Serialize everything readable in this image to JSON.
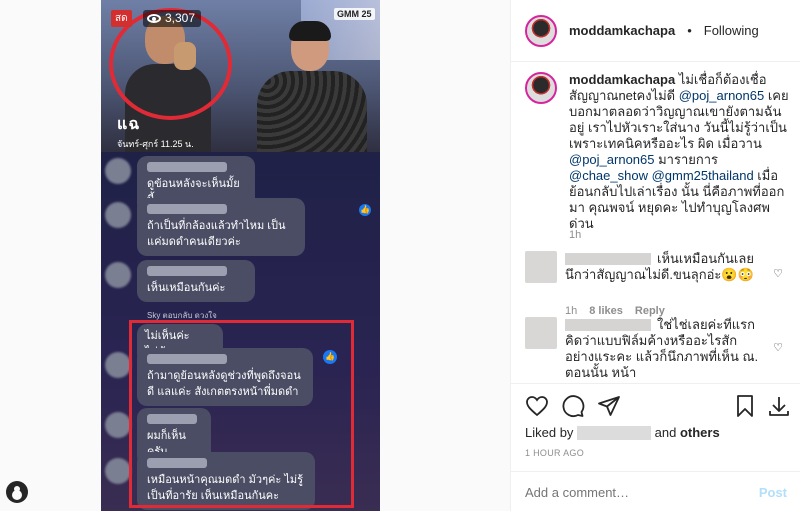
{
  "video": {
    "live_tag": "สด",
    "views": "3,307",
    "channel": "GMM 25",
    "show_logo_main": "แฉ",
    "show_logo_sub": "จันทร์-ศุกร์ 11.25 น."
  },
  "chat_overlay": {
    "messages": [
      {
        "text": "ดูข้อนหลังจะเห็นมั้ยนี้"
      },
      {
        "text": "ถ้าเป็นที่กล้องแล้วทำไหม เป็นแค่มดดำคนเดียวค่ะ"
      },
      {
        "text": "เห็นเหมือนกันค่ะ"
      },
      {
        "text": "ไม่เห็นค่ะ ไม่ทัน"
      },
      {
        "text": "ถ้ามาดูย้อนหลังดูช่วงที่พูดถึงจอนดี แลแค่ะ สังเกตตรงหน้าพี่มดดำ"
      },
      {
        "text": "ผมก็เห็นครับ"
      },
      {
        "text": "เหมือนหน้าคุณมดดำ มัวๆค่ะ ไม่รู้เป็นที่อารัย เห็นเหมือนกันคะ"
      }
    ],
    "reply_hint": "Sky ตอบกลับ ดวงใจ"
  },
  "header": {
    "username": "moddamkachapa",
    "separator": "•",
    "follow_status": "Following"
  },
  "caption": {
    "username": "moddamkachapa",
    "text_1": " ไม่เชื่อก็ต้องเชื่อ สัญญาณnetคงไม่ดี ",
    "mention_1": "@poj_arnon65",
    "text_2": " เคยบอกมาตลอดว่าวิญญาณเขายังตามฉันอยู่ เราไปหัวเราะใส่นาง วันนี้ไม่รู้ว่าเป็นเพราะเทคนิคหรืออะไร ผิด เมื่อวาน ",
    "mention_2": "@poj_arnon65",
    "text_3": " มารายการ ",
    "mention_3": "@chae_show",
    "text_4": " ",
    "mention_4": "@gmm25thailand",
    "text_5": " เมื่อย้อนกลับไปเล่าเรื่อง นั้น นี่คือภาพที่ออกมา คุณพจน์ หยุดคะ ไปทำบุญโลงศพด่วน",
    "time": "1h"
  },
  "comments": [
    {
      "text": "เห็นเหมือนกันเลย นึกว่าสัญญาณไม่ดี.ขนลุกอ่ะ😮😳",
      "time": "1h",
      "likes": "8 likes",
      "reply": "Reply"
    },
    {
      "text": "ใช่ไช่เลยค่ะที่แรกคิดว่าแบบฟิล์มค้างหรืออะไรสักอย่างแระคะ แล้วก็นึกภาพที่เห็น ณ. ตอนนั้น หน้า"
    }
  ],
  "footer": {
    "liked_by_prefix": "Liked by ",
    "liked_by_and": " and ",
    "liked_by_others": "others",
    "time_ago": "1 HOUR AGO",
    "comment_placeholder": "Add a comment…",
    "post_label": "Post"
  }
}
